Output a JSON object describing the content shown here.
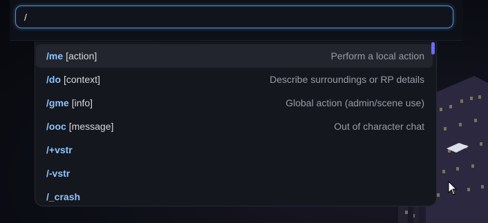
{
  "chat": {
    "input_value": "/"
  },
  "suggestions": [
    {
      "command": "/me",
      "arg": "[action]",
      "description": "Perform a local action",
      "active": true
    },
    {
      "command": "/do",
      "arg": "[context]",
      "description": "Describe surroundings or RP details",
      "active": false
    },
    {
      "command": "/gme",
      "arg": "[info]",
      "description": "Global action (admin/scene use)",
      "active": false
    },
    {
      "command": "/ooc",
      "arg": "[message]",
      "description": "Out of character chat",
      "active": false
    },
    {
      "command": "/+vstr",
      "arg": "",
      "description": "",
      "active": false
    },
    {
      "command": "/-vstr",
      "arg": "",
      "description": "",
      "active": false
    },
    {
      "command": "/_crash",
      "arg": "",
      "description": "",
      "active": false
    }
  ],
  "colors": {
    "accent": "#4a8fd6",
    "command": "#8ec4ff",
    "scrollbar": "#6f6cf0"
  }
}
